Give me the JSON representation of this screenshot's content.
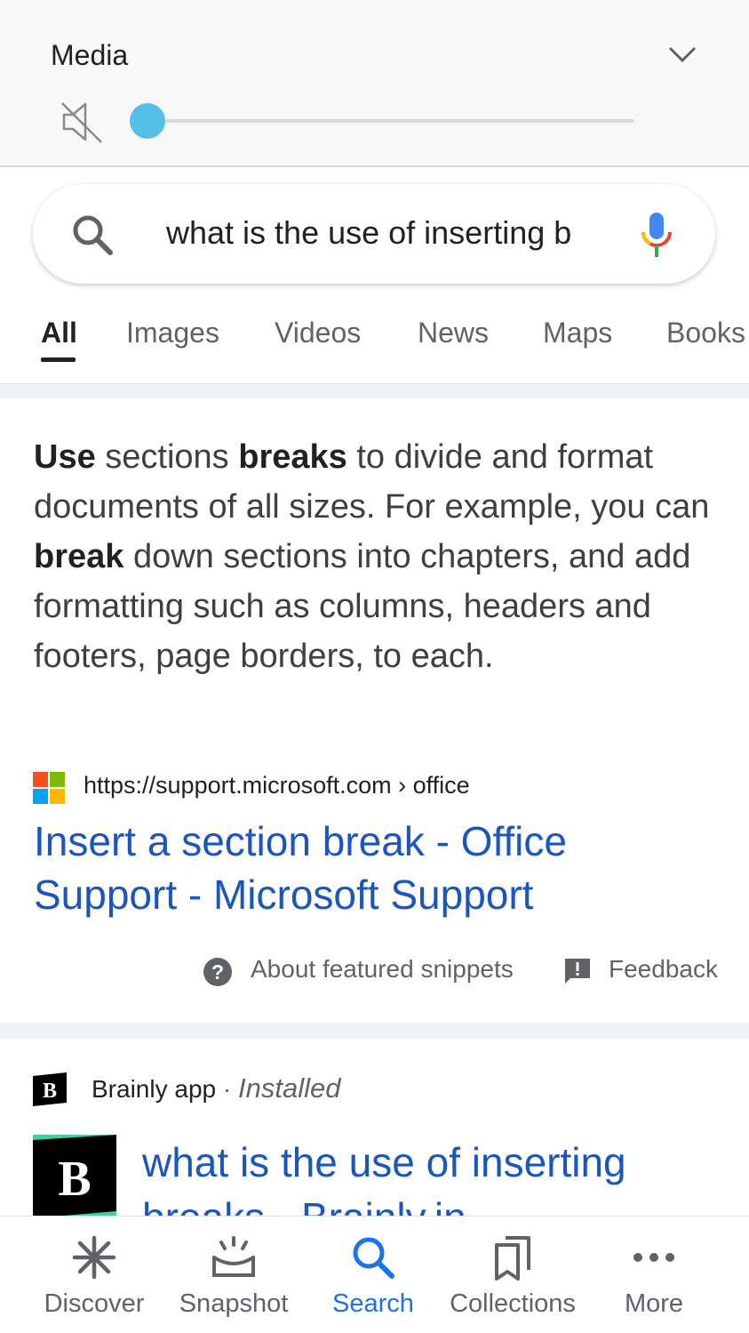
{
  "media_panel": {
    "title": "Media",
    "volume_level": 0
  },
  "search": {
    "query": "what is the use of inserting b"
  },
  "tabs": [
    {
      "label": "All",
      "active": true
    },
    {
      "label": "Images",
      "active": false
    },
    {
      "label": "Videos",
      "active": false
    },
    {
      "label": "News",
      "active": false
    },
    {
      "label": "Maps",
      "active": false
    },
    {
      "label": "Books",
      "active": false
    }
  ],
  "featured_snippet": {
    "segments": [
      {
        "text": "Use",
        "bold": true
      },
      {
        "text": " sections ",
        "bold": false
      },
      {
        "text": "breaks",
        "bold": true
      },
      {
        "text": " to divide and format documents of all sizes. For example, you can ",
        "bold": false
      },
      {
        "text": "break",
        "bold": true
      },
      {
        "text": " down sections into chapters, and add formatting such as columns, headers and footers, page borders, to each.",
        "bold": false
      }
    ],
    "source_url": "https://support.microsoft.com › office",
    "title": "Insert a section break - Office Support - Microsoft Support",
    "about_label": "About featured snippets",
    "feedback_label": "Feedback"
  },
  "brainly_result": {
    "source": "Brainly app",
    "separator": "·",
    "status": "Installed",
    "title": "what is the use of inserting breaks - Brainly.in"
  },
  "bottom_nav": [
    {
      "label": "Discover",
      "icon": "asterisk-icon",
      "active": false
    },
    {
      "label": "Snapshot",
      "icon": "snapshot-icon",
      "active": false
    },
    {
      "label": "Search",
      "icon": "search-icon",
      "active": true
    },
    {
      "label": "Collections",
      "icon": "collections-icon",
      "active": false
    },
    {
      "label": "More",
      "icon": "more-dots-icon",
      "active": false
    }
  ],
  "colors": {
    "link": "#1a55c0",
    "accent": "#1a73e8",
    "slider": "#56bfe6",
    "ms_red": "#f25022",
    "ms_green": "#7fba00",
    "ms_blue": "#00a4ef",
    "ms_yellow": "#ffb900"
  }
}
